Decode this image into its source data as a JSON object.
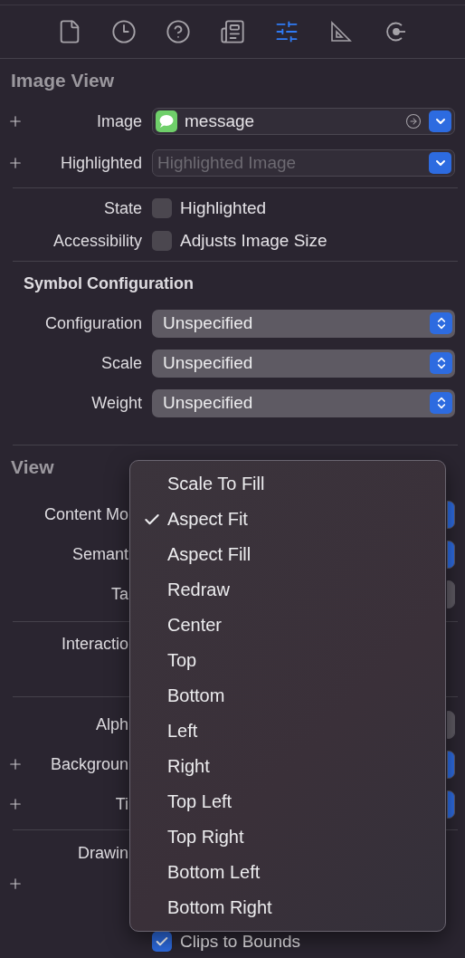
{
  "toolbar": {
    "tabs": [
      {
        "selected": false
      },
      {
        "selected": false
      },
      {
        "selected": false
      },
      {
        "selected": false
      },
      {
        "selected": true
      },
      {
        "selected": false
      },
      {
        "selected": false
      }
    ]
  },
  "image_view": {
    "title": "Image View",
    "image": {
      "label": "Image",
      "value": "message"
    },
    "highlighted": {
      "label": "Highlighted",
      "placeholder": "Highlighted Image"
    },
    "checks": [
      {
        "label": "State",
        "option": "Highlighted",
        "checked": false
      },
      {
        "label": "Accessibility",
        "option": "Adjusts Image Size",
        "checked": false
      }
    ]
  },
  "symbol_configuration": {
    "title": "Symbol Configuration",
    "rows": [
      {
        "label": "Configuration",
        "value": "Unspecified"
      },
      {
        "label": "Scale",
        "value": "Unspecified"
      },
      {
        "label": "Weight",
        "value": "Unspecified"
      }
    ]
  },
  "view": {
    "title": "View",
    "groups": [
      {
        "rows": [
          {
            "label": "Content Mo",
            "kind": "popup",
            "plus": false
          },
          {
            "label": "Semant",
            "kind": "popup",
            "plus": false
          },
          {
            "label": "Ta",
            "kind": "stepper",
            "plus": false
          }
        ]
      },
      {
        "rows": [
          {
            "label": "Interactio",
            "kind": "tall",
            "plus": false
          }
        ]
      },
      {
        "rows": [
          {
            "label": "Alph",
            "kind": "stepper",
            "plus": false
          },
          {
            "label": "Backgroun",
            "kind": "popup",
            "plus": true
          },
          {
            "label": "Ti",
            "kind": "popup",
            "plus": true
          }
        ]
      },
      {
        "rows": [
          {
            "label": "Drawin",
            "kind": "plain",
            "plus": false
          },
          {
            "kind": "plain",
            "plus": true
          }
        ]
      }
    ],
    "clips": {
      "option": "Clips to Bounds",
      "checked": true
    }
  },
  "menu": {
    "items": [
      {
        "label": "Scale To Fill",
        "selected": false
      },
      {
        "label": "Aspect Fit",
        "selected": true
      },
      {
        "label": "Aspect Fill",
        "selected": false
      },
      {
        "label": "Redraw",
        "selected": false
      },
      {
        "label": "Center",
        "selected": false
      },
      {
        "label": "Top",
        "selected": false
      },
      {
        "label": "Bottom",
        "selected": false
      },
      {
        "label": "Left",
        "selected": false
      },
      {
        "label": "Right",
        "selected": false
      },
      {
        "label": "Top Left",
        "selected": false
      },
      {
        "label": "Top Right",
        "selected": false
      },
      {
        "label": "Bottom Left",
        "selected": false
      },
      {
        "label": "Bottom Right",
        "selected": false
      }
    ]
  }
}
